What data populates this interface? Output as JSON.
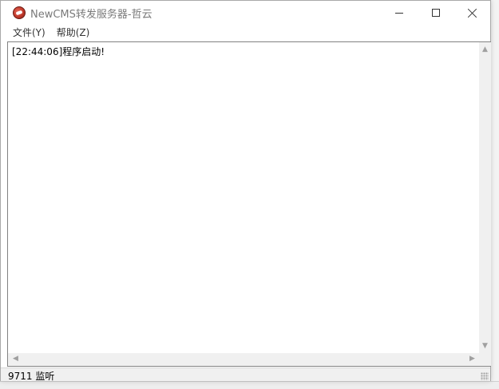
{
  "window": {
    "title": "NewCMS转发服务器-哲云"
  },
  "menu": {
    "items": [
      {
        "label": "文件(Y)"
      },
      {
        "label": "帮助(Z)"
      }
    ]
  },
  "log": {
    "lines": [
      "[22:44:06]程序启动!"
    ]
  },
  "status": {
    "text": "9711 监听"
  },
  "icons": {
    "app": "app-logo-icon",
    "minimize": "minimize-icon",
    "maximize": "maximize-icon",
    "close": "close-icon"
  },
  "colors": {
    "title_text": "#7a7a7a",
    "window_bg": "#ffffff",
    "chrome_bg": "#f0f0f0"
  }
}
